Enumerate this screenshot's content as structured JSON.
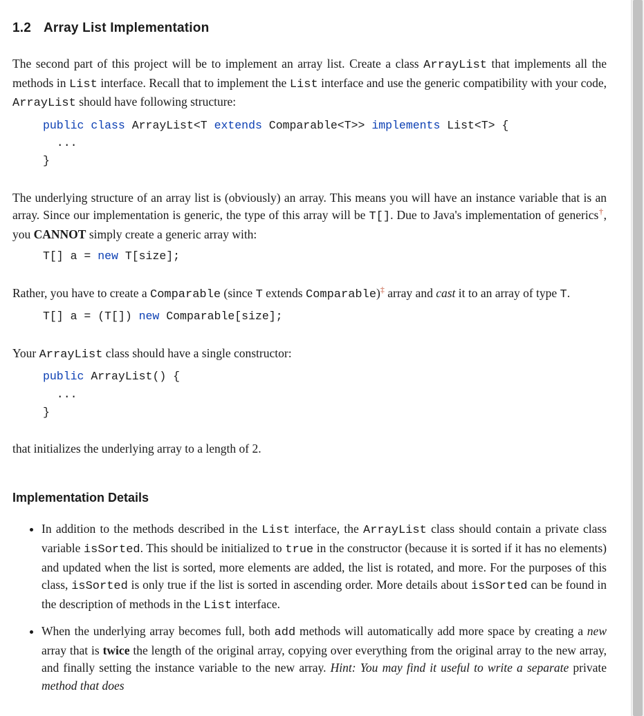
{
  "section": {
    "number": "1.2",
    "title": "Array List Implementation"
  },
  "para1": {
    "t1": "The second part of this project will be to implement an array list. Create a class ",
    "c1": "ArrayList",
    "t2": " that implements all the methods in ",
    "c2": "List",
    "t3": " interface. Recall that to implement the ",
    "c3": "List",
    "t4": " interface and use the generic compatibility with your code, ",
    "c4": "ArrayList",
    "t5": " should have following structure:"
  },
  "code1": {
    "k_public": "public",
    "k_class": "class",
    "c_name": " ArrayList<T ",
    "k_extends": "extends",
    "c_comp": " Comparable<T>> ",
    "k_implements": "implements",
    "c_tail": " List<T> {",
    "dots": "  ...",
    "close": "}"
  },
  "para2": {
    "t1": "The underlying structure of an array list is (obviously) an array.  This means you will have an instance variable that is an array. Since our implementation is generic, the type of this array will be ",
    "c1": "T[]",
    "t2": ". Due to Java's implementation of generics",
    "fn1": "†",
    "t3": ", you ",
    "b1": "CANNOT",
    "t4": " simply create a generic array with:"
  },
  "code2": {
    "lhs": "T[] a = ",
    "k_new": "new",
    "rhs": " T[size];"
  },
  "para3": {
    "t1": "Rather, you have to create a ",
    "c1": "Comparable",
    "t2": " (since ",
    "c2": "T",
    "t3": " extends ",
    "c3": "Comparable",
    "t4": ")",
    "fn2": "‡",
    "t5": " array and ",
    "i1": "cast",
    "t6": " it to an array of type ",
    "c4": "T",
    "t7": "."
  },
  "code3": {
    "lhs": "T[] a = (T[]) ",
    "k_new": "new",
    "rhs": " Comparable[size];"
  },
  "para4": {
    "t1": "Your ",
    "c1": "ArrayList",
    "t2": " class should have a single constructor:"
  },
  "code4": {
    "k_public": "public",
    "c_sig": " ArrayList() {",
    "dots": "  ...",
    "close": "}"
  },
  "para5": {
    "t1": "that initializes the underlying array to a length of 2."
  },
  "subsection": "Implementation Details",
  "bullet1": {
    "t1": "In addition to the methods described in the ",
    "c1": "List",
    "t2": " interface, the ",
    "c2": "ArrayList",
    "t3": " class should contain a private class variable ",
    "c3": "isSorted",
    "t4": ".  This should be initialized to ",
    "c4": "true",
    "t5": " in the constructor (because it is sorted if it has no elements) and updated when the list is sorted, more elements are added, the list is rotated, and more. For the purposes of this class, ",
    "c5": "isSorted",
    "t6": " is only true if the list is sorted in ascending order.  More details about ",
    "c6": "isSorted",
    "t7": " can be found in the description of methods in the ",
    "c7": "List",
    "t8": " interface."
  },
  "bullet2": {
    "t1": "When the underlying array becomes full, both ",
    "c1": "add",
    "t2": " methods will automatically add more space by creating a ",
    "i1": "new",
    "t3": " array that is ",
    "b1": "twice",
    "t4": " the length of the original array, copying over everything from the original array to the new array, and finally setting the instance variable to the new array.  ",
    "i2": "Hint: You may find it useful to write a separate ",
    "t5": "private",
    "i3": " method that does"
  }
}
